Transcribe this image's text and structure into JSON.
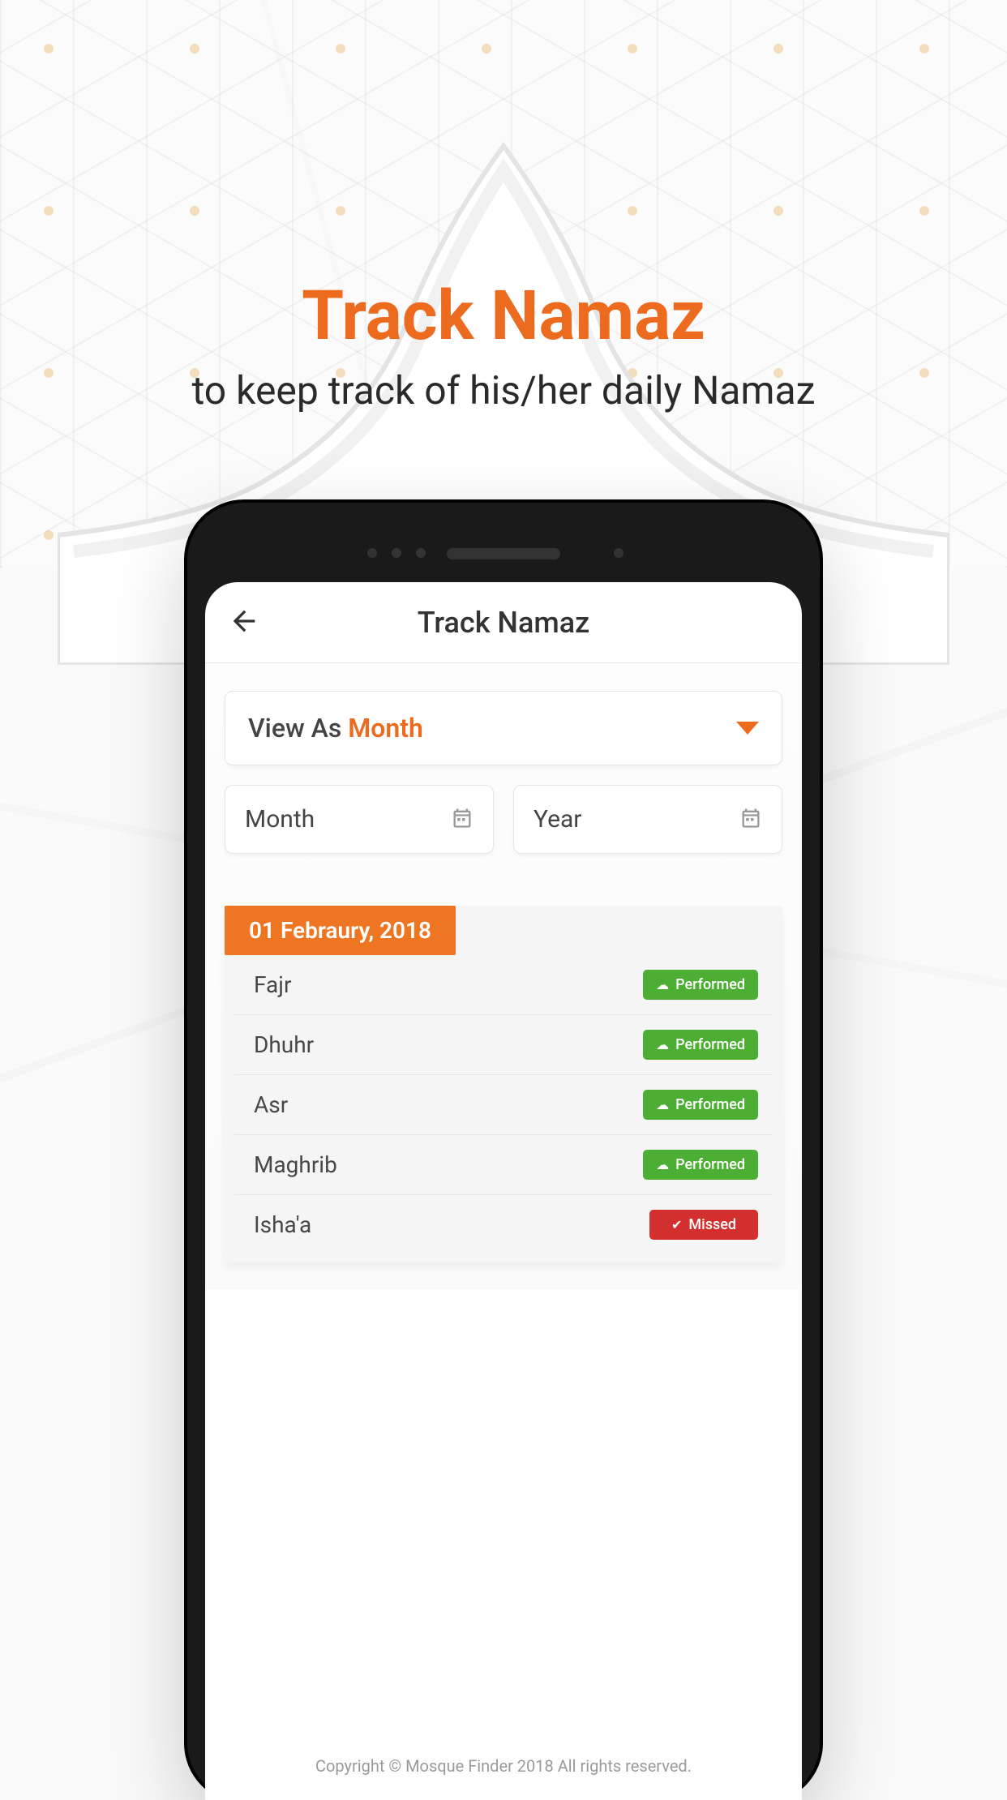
{
  "promo": {
    "title": "Track Namaz",
    "subtitle": "to keep track of his/her daily Namaz"
  },
  "app": {
    "title": "Track Namaz",
    "viewas_label": "View As ",
    "viewas_value": "Month",
    "month_label": "Month",
    "year_label": "Year",
    "date_header": "01 Febraury, 2018",
    "prayers": [
      {
        "name": "Fajr",
        "status": "Performed",
        "kind": "performed"
      },
      {
        "name": "Dhuhr",
        "status": "Performed",
        "kind": "performed"
      },
      {
        "name": "Asr",
        "status": "Performed",
        "kind": "performed"
      },
      {
        "name": "Maghrib",
        "status": "Performed",
        "kind": "performed"
      },
      {
        "name": "Isha'a",
        "status": "Missed",
        "kind": "missed"
      }
    ],
    "copyright": "Copyright © Mosque Finder 2018  All rights reserved."
  },
  "colors": {
    "accent": "#ec6b1f",
    "performed": "#4caf34",
    "missed": "#d32f2f"
  }
}
